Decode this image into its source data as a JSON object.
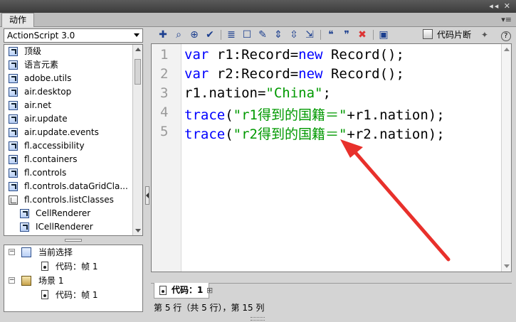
{
  "panel": {
    "tab_label": "动作",
    "menu_icon": "panel-menu-icon"
  },
  "toolbox": {
    "language": "ActionScript 3.0",
    "items": [
      {
        "label": "顶级",
        "indent": 0,
        "icon": "package-icon"
      },
      {
        "label": "语言元素",
        "indent": 0,
        "icon": "package-icon"
      },
      {
        "label": "adobe.utils",
        "indent": 0,
        "icon": "package-icon"
      },
      {
        "label": "air.desktop",
        "indent": 0,
        "icon": "package-icon"
      },
      {
        "label": "air.net",
        "indent": 0,
        "icon": "package-icon"
      },
      {
        "label": "air.update",
        "indent": 0,
        "icon": "package-icon"
      },
      {
        "label": "air.update.events",
        "indent": 0,
        "icon": "package-icon"
      },
      {
        "label": "fl.accessibility",
        "indent": 0,
        "icon": "package-icon"
      },
      {
        "label": "fl.containers",
        "indent": 0,
        "icon": "package-icon"
      },
      {
        "label": "fl.controls",
        "indent": 0,
        "icon": "package-icon"
      },
      {
        "label": "fl.controls.dataGridCla...",
        "indent": 0,
        "icon": "package-icon"
      },
      {
        "label": "fl.controls.listClasses",
        "indent": 0,
        "icon": "open-package-icon"
      },
      {
        "label": "CellRenderer",
        "indent": 1,
        "icon": "class-icon"
      },
      {
        "label": "ICellRenderer",
        "indent": 1,
        "icon": "class-icon"
      }
    ]
  },
  "script_nav": {
    "items": [
      {
        "label": "当前选择",
        "level": 0,
        "icon": "selection-icon"
      },
      {
        "label": "代码：帧 1",
        "level": 1,
        "icon": "frame-icon"
      },
      {
        "label": "场景 1",
        "level": 0,
        "icon": "scene-icon"
      },
      {
        "label": "代码：帧 1",
        "level": 1,
        "icon": "frame-icon"
      }
    ]
  },
  "toolbar": {
    "tools": [
      "add-icon",
      "find-icon",
      "target-icon",
      "check-syntax-icon",
      "auto-format-icon",
      "code-hint-icon",
      "debug-icon",
      "collapse-icon",
      "expand-icon",
      "collapse-all-icon",
      "comment-icon",
      "line-comment-icon",
      "uncomment-icon",
      "script-assist-icon"
    ],
    "snippets_label": "代码片断",
    "help_label": "?"
  },
  "editor": {
    "line_numbers": [
      "1",
      "2",
      "3",
      "4",
      "5"
    ],
    "lines": [
      [
        {
          "t": "var",
          "c": "kw"
        },
        {
          "t": " r1:Record=",
          "c": ""
        },
        {
          "t": "new",
          "c": "kw"
        },
        {
          "t": " Record();",
          "c": ""
        }
      ],
      [
        {
          "t": "var",
          "c": "kw"
        },
        {
          "t": " r2:Record=",
          "c": ""
        },
        {
          "t": "new",
          "c": "kw"
        },
        {
          "t": " Record();",
          "c": ""
        }
      ],
      [
        {
          "t": "r1.nation=",
          "c": ""
        },
        {
          "t": "\"China\"",
          "c": "str"
        },
        {
          "t": ";",
          "c": ""
        }
      ],
      [
        {
          "t": "trace",
          "c": "fn"
        },
        {
          "t": "(",
          "c": ""
        },
        {
          "t": "\"r1得到的国籍＝\"",
          "c": "str"
        },
        {
          "t": "+r1.nation);",
          "c": ""
        }
      ],
      [
        {
          "t": "trace",
          "c": "fn"
        },
        {
          "t": "(",
          "c": ""
        },
        {
          "t": "\"r2得到的国籍＝\"",
          "c": "str"
        },
        {
          "t": "+r2.nation);",
          "c": ""
        }
      ]
    ]
  },
  "doc_tab": {
    "label": "代码：1"
  },
  "status": {
    "text": "第 5 行（共 5 行），第 15 列"
  },
  "colors": {
    "keyword": "#0000ff",
    "string": "#009900",
    "arrow": "#e8302b"
  }
}
